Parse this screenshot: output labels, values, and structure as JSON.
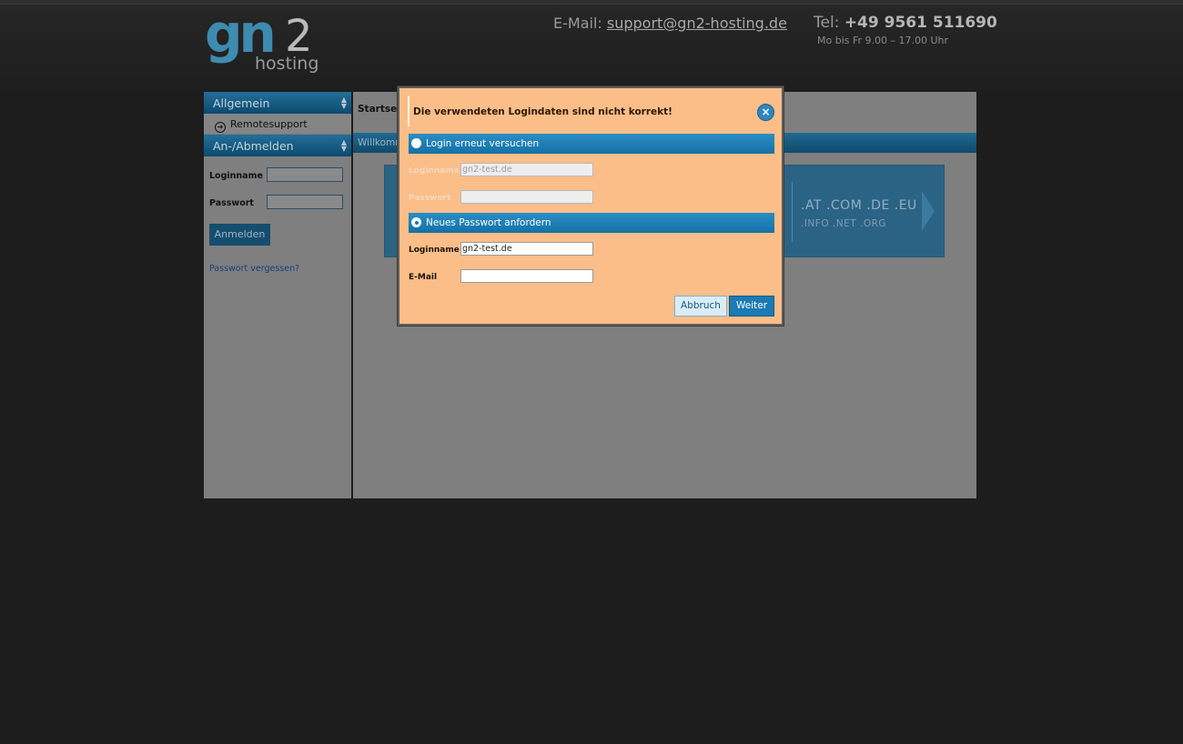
{
  "header": {
    "logo_main": "gn",
    "logo_num": "2",
    "logo_sub": "hosting",
    "email_label": "E-Mail:",
    "email": "support@gn2-hosting.de",
    "tel_label": "Tel:",
    "tel": "+49 9561 511690",
    "hours": "Mo bis Fr  9.00 – 17.00 Uhr"
  },
  "sidebar": {
    "section1": "Allgemein",
    "item1": "Remotesupport",
    "section2": "An-/Abmelden",
    "login_label": "Loginname",
    "password_label": "Passwort",
    "login_button": "Anmelden",
    "forgot_link": "Passwort vergessen?"
  },
  "main": {
    "breadcrumb": "Startsei",
    "welcome": "Willkomm",
    "tld_line1": ".AT .COM .DE .EU",
    "tld_line2": ".INFO .NET .ORG"
  },
  "dialog": {
    "title": "Die verwendeten Logindaten sind nicht korrekt!",
    "close_symbol": "×",
    "option1": "Login erneut versuchen",
    "option1_login_label": "Loginname",
    "option1_login_value": "gn2-test.de",
    "option1_password_label": "Passwort",
    "option2": "Neues Passwort anfordern",
    "option2_login_label": "Loginname",
    "option2_login_value": "gn2-test.de",
    "option2_email_label": "E-Mail",
    "option2_email_value": "",
    "selected_option": 2,
    "cancel_button": "Abbruch",
    "next_button": "Weiter"
  },
  "colors": {
    "dialog_bg": "#fbbe88",
    "accent_blue": "#1c7ab4",
    "overlay": "#1d1d1d"
  }
}
